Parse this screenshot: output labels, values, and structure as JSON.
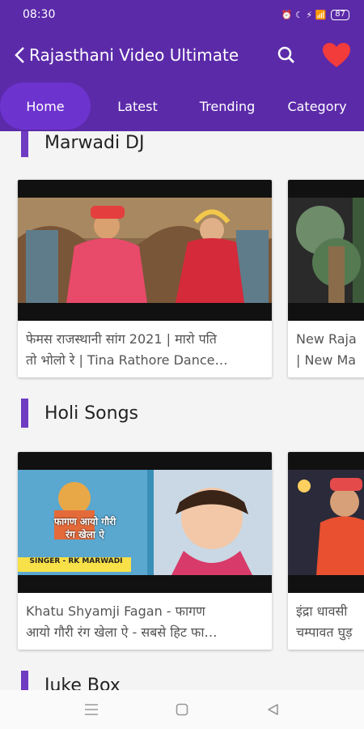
{
  "status": {
    "time": "08:30",
    "icons_text": "⏰ ☾ ⚡ 📶",
    "battery": "87"
  },
  "appbar": {
    "title": "Rajasthani Video Ultimate"
  },
  "tabs": [
    {
      "label": "Home",
      "active": true
    },
    {
      "label": "Latest",
      "active": false
    },
    {
      "label": "Trending",
      "active": false
    },
    {
      "label": "Category",
      "active": false
    }
  ],
  "sections": [
    {
      "title": "Marwadi DJ",
      "cards": [
        {
          "line1": "फेमस राजस्थानी सांग 2021 | मारो पति",
          "line2": "तो भोलो रे | Tina Rathore Dance…"
        },
        {
          "line1": "New Raja",
          "line2": "| New Ma"
        }
      ]
    },
    {
      "title": "Holi Songs",
      "cards": [
        {
          "line1": "Khatu Shyamji Fagan - फागण",
          "line2": "आयो गौरी रंग खेला ऐ - सबसे हिट फा…",
          "thumb_text1": "फागण आयो गौरी",
          "thumb_text2": "रंग खेला ऐ",
          "thumb_singer": "SINGER - RK MARWADI"
        },
        {
          "line1": "इंद्रा धावसी",
          "line2": "चम्पावत घुड़"
        }
      ]
    },
    {
      "title": "Juke Box"
    }
  ],
  "colors": {
    "primary": "#5b2aa9",
    "accent_bar": "#6f3bc2",
    "heart": "#f23b3b"
  }
}
